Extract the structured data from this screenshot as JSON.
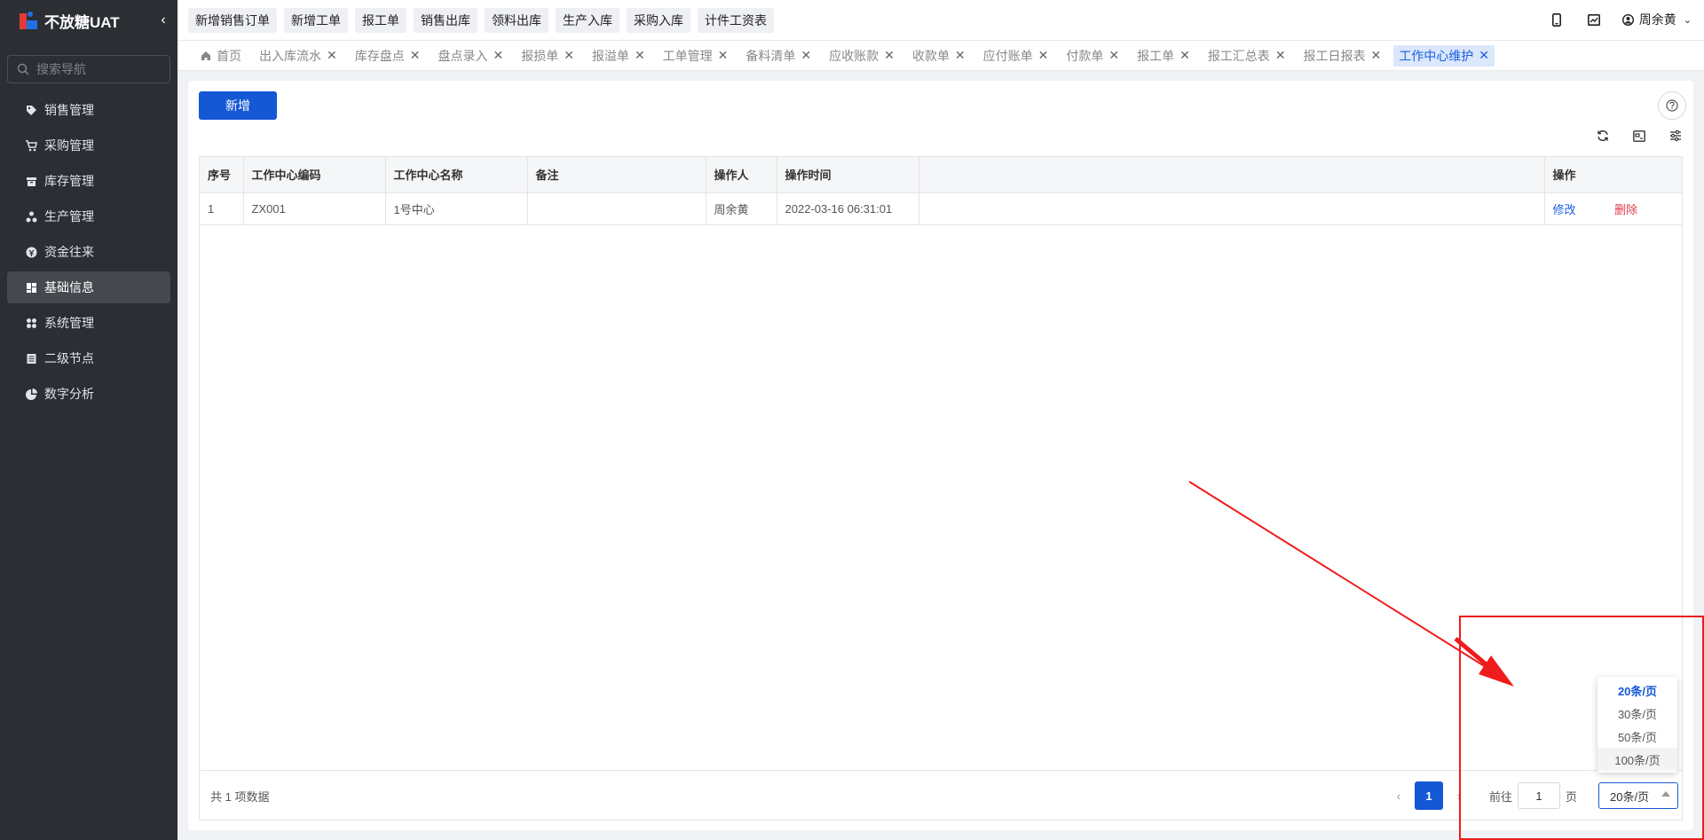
{
  "sidebar": {
    "app_name": "不放糖UAT",
    "search_placeholder": "搜索导航",
    "items": [
      {
        "label": "销售管理",
        "icon": "tag-icon"
      },
      {
        "label": "采购管理",
        "icon": "cart-icon"
      },
      {
        "label": "库存管理",
        "icon": "warehouse-icon"
      },
      {
        "label": "生产管理",
        "icon": "nodes-icon"
      },
      {
        "label": "资金往来",
        "icon": "coin-icon"
      },
      {
        "label": "基础信息",
        "icon": "grid-icon",
        "active": true
      },
      {
        "label": "系统管理",
        "icon": "apps-icon"
      },
      {
        "label": "二级节点",
        "icon": "list-icon"
      },
      {
        "label": "数字分析",
        "icon": "pie-icon"
      }
    ]
  },
  "topbar": {
    "quick_buttons": [
      "新增销售订单",
      "新增工单",
      "报工单",
      "销售出库",
      "领料出库",
      "生产入库",
      "采购入库",
      "计件工资表"
    ],
    "user_name": "周余黄"
  },
  "tabs": [
    {
      "label": "首页",
      "closable": false
    },
    {
      "label": "出入库流水",
      "closable": true
    },
    {
      "label": "库存盘点",
      "closable": true
    },
    {
      "label": "盘点录入",
      "closable": true
    },
    {
      "label": "报损单",
      "closable": true
    },
    {
      "label": "报溢单",
      "closable": true
    },
    {
      "label": "工单管理",
      "closable": true
    },
    {
      "label": "备料清单",
      "closable": true
    },
    {
      "label": "应收账款",
      "closable": true
    },
    {
      "label": "收款单",
      "closable": true
    },
    {
      "label": "应付账单",
      "closable": true
    },
    {
      "label": "付款单",
      "closable": true
    },
    {
      "label": "报工单",
      "closable": true
    },
    {
      "label": "报工汇总表",
      "closable": true
    },
    {
      "label": "报工日报表",
      "closable": true
    },
    {
      "label": "工作中心维护",
      "closable": true,
      "active": true
    }
  ],
  "main": {
    "add_label": "新增",
    "table": {
      "headers": [
        "序号",
        "工作中心编码",
        "工作中心名称",
        "备注",
        "操作人",
        "操作时间",
        "",
        "操作"
      ],
      "rows": [
        {
          "index": "1",
          "code": "ZX001",
          "name": "1号中心",
          "remark": "",
          "operator": "周余黄",
          "time": "2022-03-16 06:31:01",
          "edit": "修改",
          "delete": "删除"
        }
      ]
    },
    "pagination": {
      "total_text": "共 1 项数据",
      "current_page": "1",
      "goto_prefix": "前往",
      "goto_value": "1",
      "goto_suffix": "页",
      "page_size": "20条/页",
      "page_size_options": [
        "20条/页",
        "30条/页",
        "50条/页",
        "100条/页"
      ]
    }
  },
  "colors": {
    "primary": "#1558d6",
    "danger": "#e0394a",
    "annotation": "#ee1c1c",
    "sidebar_bg": "#2b2e33"
  }
}
